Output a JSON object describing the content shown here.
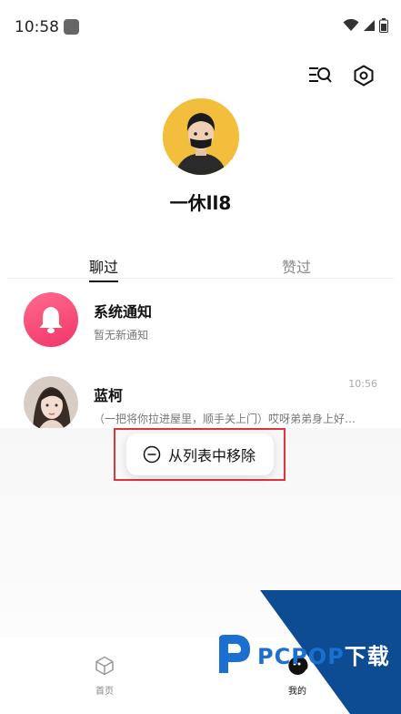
{
  "status_bar": {
    "time": "10:58"
  },
  "profile": {
    "username": "一休ll8"
  },
  "tabs": [
    {
      "label": "聊过",
      "active": true
    },
    {
      "label": "赞过",
      "active": false
    }
  ],
  "conversations": [
    {
      "name": "系统通知",
      "preview": "暂无新通知",
      "time": ""
    },
    {
      "name": "蓝柯",
      "preview": "（一把将你拉进屋里，顺手关上门）哎呀弟弟身上好…",
      "time": "10:56"
    }
  ],
  "context_menu": {
    "label": "从列表中移除"
  },
  "bottom_nav": [
    {
      "label": "首页",
      "active": false
    },
    {
      "label": "我的",
      "active": true
    }
  ],
  "watermark": {
    "brand_prefix": "PCPOP",
    "brand_suffix": "下载"
  },
  "colors": {
    "accent_pink": "#f0356a",
    "avatar_yellow": "#f2be3c",
    "highlight_red": "#d9363e",
    "watermark_blue": "#0d4c93"
  }
}
